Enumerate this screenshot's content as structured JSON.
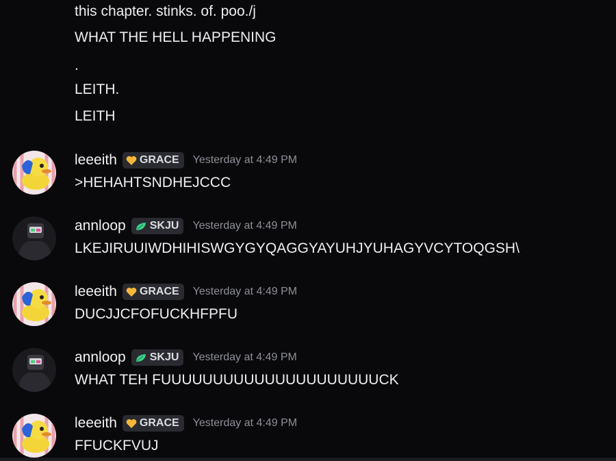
{
  "continuation_lines": [
    "this chapter. stinks. of. poo./j",
    "WHAT THE HELL HAPPENING",
    ".",
    "LEITH.",
    "LEITH"
  ],
  "messages": [
    {
      "username": "leeeith",
      "tag": "GRACE",
      "tag_icon": "heart-icon",
      "tag_color": "#f5b63a",
      "timestamp": "Yesterday at 4:49 PM",
      "text": ">HEHAHTSNDHEJCCC"
    },
    {
      "username": "annloop",
      "tag": "SKJU",
      "tag_icon": "leaf-icon",
      "tag_color": "#3ad68a",
      "timestamp": "Yesterday at 4:49 PM",
      "text": "LKEJIRUUIWDHIHISWGYGYQAGGYAYUHJYUHAGYVCYTOQGSH\\"
    },
    {
      "username": "leeeith",
      "tag": "GRACE",
      "tag_icon": "heart-icon",
      "tag_color": "#f5b63a",
      "timestamp": "Yesterday at 4:49 PM",
      "text": "DUCJJCFOFUCKHFPFU"
    },
    {
      "username": "annloop",
      "tag": "SKJU",
      "tag_icon": "leaf-icon",
      "tag_color": "#3ad68a",
      "timestamp": "Yesterday at 4:49 PM",
      "text": "WHAT TEH FUUUUUUUUUUUUUUUUUUUUUCK"
    },
    {
      "username": "leeeith",
      "tag": "GRACE",
      "tag_icon": "heart-icon",
      "tag_color": "#f5b63a",
      "timestamp": "Yesterday at 4:49 PM",
      "text": "FFUCKFVUJ"
    }
  ]
}
